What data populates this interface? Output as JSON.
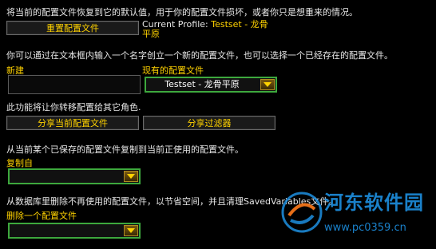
{
  "reset_desc": "将当前的配置文件恢复到它的默认值，用于你的配置文件损坏，或者你只是想重来的情况。",
  "reset_button": "重置配置文件",
  "current_profile_label": "Current Profile:",
  "current_profile_value_line1": "Testset - 龙骨",
  "current_profile_value_line2": "平原",
  "create_desc": "你可以通过在文本框内输入一个名字创立一个新的配置文件，也可以选择一个已经存在的配置文件。",
  "new_label": "新建",
  "new_input_value": "",
  "existing_label": "现有的配置文件",
  "existing_value": "Testset - 龙骨平原",
  "transfer_desc": "此功能将让你转移配置给其它角色.",
  "share_current_button": "分享当前配置文件",
  "share_filter_button": "分享过滤器",
  "copy_desc": "从当前某个已保存的配置文件复制到当前正使用的配置文件。",
  "copy_from_label": "复制自",
  "copy_from_value": "",
  "delete_desc": "从数据库里删除不再使用的配置文件，以节省空间，并且清理SavedVariables文件。",
  "delete_label": "删除一个配置文件",
  "delete_value": "",
  "watermark_title": "河东软件园",
  "watermark_url": "www.pc0359.cn",
  "colors": {
    "gold": "#ffd200",
    "green_border": "#3da83d",
    "watermark": "#1d8fe0"
  }
}
